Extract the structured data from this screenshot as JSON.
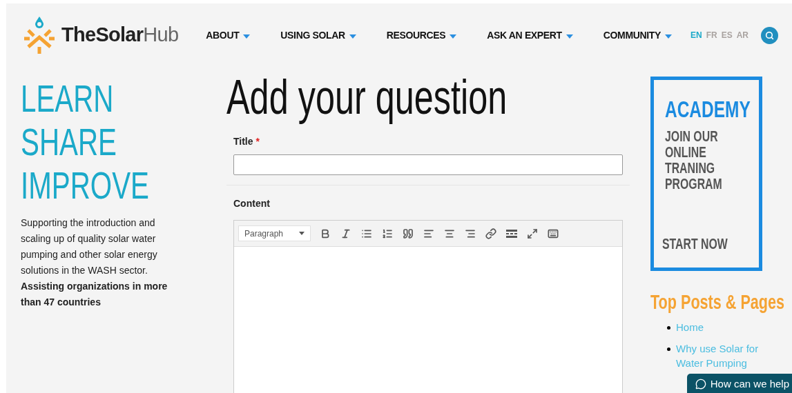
{
  "header": {
    "logo": {
      "bold": "TheSolar",
      "light": "Hub"
    },
    "nav": [
      {
        "label": "ABOUT"
      },
      {
        "label": "USING SOLAR"
      },
      {
        "label": "RESOURCES"
      },
      {
        "label": "ASK AN EXPERT"
      },
      {
        "label": "COMMUNITY"
      }
    ],
    "languages": [
      {
        "label": "EN",
        "selected": true
      },
      {
        "label": "FR",
        "selected": false
      },
      {
        "label": "ES",
        "selected": false
      },
      {
        "label": "AR",
        "selected": false
      }
    ]
  },
  "tagline": [
    "LEARN",
    "SHARE",
    "IMPROVE"
  ],
  "intro": {
    "text": "Supporting the introduction and scaling up of quality solar water pumping and other solar energy solutions in the WASH sector.",
    "bold": "Assisting organizations in more than 47 countries"
  },
  "form": {
    "heading": "Add your question",
    "title_label": "Title",
    "required_mark": "*",
    "content_label": "Content",
    "format_select": "Paragraph"
  },
  "academy": {
    "title": "ACADEMY",
    "text": "JOIN OUR ONLINE TRANING PROGRAM",
    "cta": "START NOW"
  },
  "top_posts": {
    "heading": "Top Posts & Pages",
    "items": [
      "Home",
      "Why use Solar for Water Pumping"
    ]
  },
  "chat_button": "How can we help"
}
